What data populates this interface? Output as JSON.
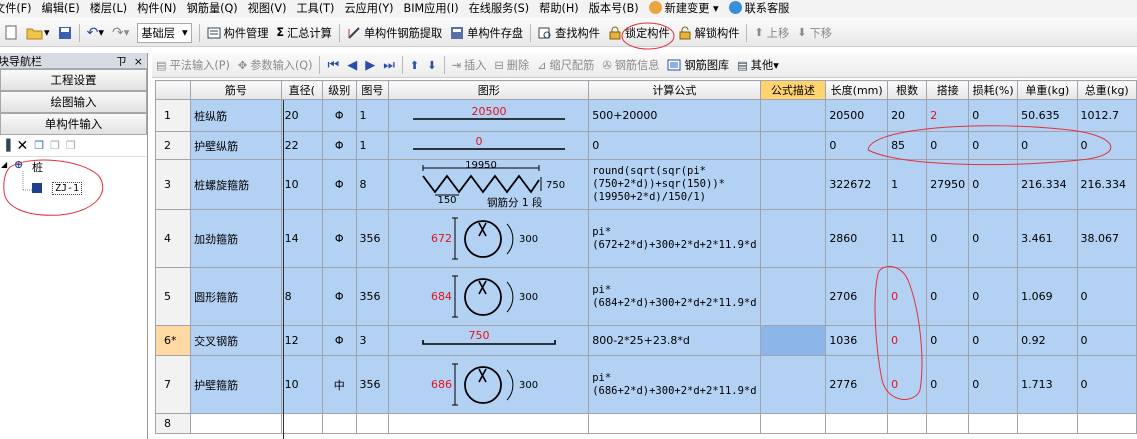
{
  "menu": [
    "文件(F)",
    "编辑(E)",
    "楼层(L)",
    "构件(N)",
    "钢筋量(Q)",
    "视图(V)",
    "工具(T)",
    "云应用(Y)",
    "BIM应用(I)",
    "在线服务(S)",
    "帮助(H)",
    "版本号(B)"
  ],
  "menu_extra": {
    "new_change": "新建变更",
    "contact": "联系客服"
  },
  "toolbar": {
    "floor": "基础层",
    "component_manage": "构件管理",
    "sum_calc": "汇总计算",
    "single_extract": "单构件钢筋提取",
    "single_save": "单构件存盘",
    "find_component": "查找构件",
    "lock_component": "锁定构件",
    "unlock_component": "解锁构件",
    "move_up": "上移",
    "move_down": "下移"
  },
  "nav": {
    "title": "块导航栏",
    "pin": "ㄗ",
    "close": "×",
    "buttons": [
      "工程设置",
      "绘图输入",
      "单构件输入"
    ],
    "tree_root": "桩",
    "tree_child": "ZJ-1"
  },
  "grid_toolbar": {
    "plan_input": "平法输入(P)",
    "param_input": "参数输入(Q)",
    "insert": "插入",
    "delete": "删除",
    "scale_rebar": "缩尺配筋",
    "rebar_info": "钢筋信息",
    "rebar_lib": "钢筋图库",
    "other": "其他"
  },
  "columns": [
    "",
    "筋号",
    "直径(",
    "级别",
    "图号",
    "图形",
    "计算公式",
    "公式描述",
    "长度(mm)",
    "根数",
    "搭接",
    "损耗(%)",
    "单重(kg)",
    "总重(kg)"
  ],
  "rows": [
    {
      "no": "1",
      "name": "桩纵筋",
      "dia": "20",
      "grade": "Φ",
      "fig": "1",
      "formula": "500+20000",
      "desc": "",
      "len": "20500",
      "count": "20",
      "lap": "2",
      "loss": "0",
      "unit": "50.635",
      "total": "1012.7",
      "fig_label": "20500"
    },
    {
      "no": "2",
      "name": "护壁纵筋",
      "dia": "22",
      "grade": "Φ",
      "fig": "1",
      "formula": "0",
      "desc": "",
      "len": "0",
      "count": "85",
      "lap": "0",
      "loss": "0",
      "unit": "0",
      "total": "0",
      "fig_label": "0"
    },
    {
      "no": "3",
      "name": "桩螺旋箍筋",
      "dia": "10",
      "grade": "Φ",
      "fig": "8",
      "formula": "round(sqrt(sqr(pi*(750+2*d))+sqr(150))*(19950+2*d)/150/1)",
      "desc": "",
      "len": "322672",
      "count": "1",
      "lap": "27950",
      "loss": "0",
      "unit": "216.334",
      "total": "216.334",
      "fig_top": "19950",
      "fig_right": "750",
      "fig_pitch": "150",
      "fig_note": "钢筋分 1 段"
    },
    {
      "no": "4",
      "name": "加劲箍筋",
      "dia": "14",
      "grade": "Φ",
      "fig": "356",
      "formula": "pi*(672+2*d)+300+2*d+2*11.9*d",
      "desc": "",
      "len": "2860",
      "count": "11",
      "lap": "0",
      "loss": "0",
      "unit": "3.461",
      "total": "38.067",
      "fig_d": "672",
      "fig_w": "300"
    },
    {
      "no": "5",
      "name": "圆形箍筋",
      "dia": "8",
      "grade": "Φ",
      "fig": "356",
      "formula": "pi*(684+2*d)+300+2*d+2*11.9*d",
      "desc": "",
      "len": "2706",
      "count": "0",
      "lap": "0",
      "loss": "0",
      "unit": "1.069",
      "total": "0",
      "fig_d": "684",
      "fig_w": "300"
    },
    {
      "no": "6*",
      "name": "交叉钢筋",
      "dia": "12",
      "grade": "Φ",
      "fig": "3",
      "formula": "800-2*25+23.8*d",
      "desc": "",
      "len": "1036",
      "count": "0",
      "lap": "0",
      "loss": "0",
      "unit": "0.92",
      "total": "0",
      "fig_label": "750"
    },
    {
      "no": "7",
      "name": "护壁箍筋",
      "dia": "10",
      "grade": "中",
      "fig": "356",
      "formula": "pi*(686+2*d)+300+2*d+2*11.9*d",
      "desc": "",
      "len": "2776",
      "count": "0",
      "lap": "0",
      "loss": "0",
      "unit": "1.713",
      "total": "0",
      "fig_d": "686",
      "fig_w": "300"
    },
    {
      "no": "8",
      "name": "",
      "dia": "",
      "grade": "",
      "fig": "",
      "formula": "",
      "desc": "",
      "len": "",
      "count": "",
      "lap": "",
      "loss": "",
      "unit": "",
      "total": ""
    }
  ]
}
